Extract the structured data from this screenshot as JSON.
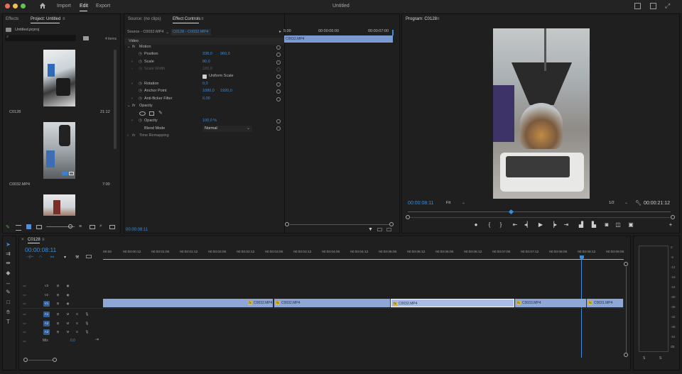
{
  "titlebar": {
    "nav": [
      "Import",
      "Edit",
      "Export"
    ],
    "title": "Untitled",
    "home_icon": "home-icon",
    "colors": {
      "close": "#ed6a5e",
      "minimize": "#f5bf4f",
      "zoom": "#61c554"
    }
  },
  "project_panel": {
    "tabs": [
      "Effects",
      "Project: Untitled"
    ],
    "file": "Untitled.prproj",
    "count": "4 items",
    "items": [
      {
        "name": "C0128",
        "duration": "21:12"
      },
      {
        "name": "C0032.MP4",
        "duration": "7:00"
      }
    ]
  },
  "effect_controls": {
    "tabs": [
      "Source: (no clips)",
      "Effect Controls"
    ],
    "master": "Source - C0032.MP4",
    "sequence_clip": "C0128 - C0032.MP4",
    "section_video": "Video",
    "motion": "Motion",
    "position_label": "Position",
    "position_x": "338,0",
    "position_y": "960,0",
    "scale_label": "Scale",
    "scale_value": "80,0",
    "scale_width_label": "Scale Width",
    "scale_width_value": "100,0",
    "uniform_scale_label": "Uniform Scale",
    "rotation_label": "Rotation",
    "rotation_value": "0,0",
    "anchor_label": "Anchor Point",
    "anchor_x": "1080,0",
    "anchor_y": "1920,0",
    "antiflicker_label": "Anti-flicker Filter",
    "antiflicker_value": "0,00",
    "opacity_section": "Opacity",
    "opacity_label": "Opacity",
    "opacity_value": "100,0 %",
    "blend_label": "Blend Mode",
    "blend_value": "Normal",
    "time_remap": "Time Remapping",
    "mini_times": [
      "5:00",
      "00:00:06:00",
      "00:00:07:00"
    ],
    "mini_clip": "C0032.MP4",
    "timecode": "00:00:08:11"
  },
  "program_monitor": {
    "title": "Program: C0128",
    "timecode": "00:00:08:11",
    "fit": "Fit",
    "resolution": "1/2",
    "duration": "00:00:21:12"
  },
  "timeline": {
    "tab": "C0128",
    "timecode": "00:00:08:11",
    "ruler": [
      "00:00",
      "00:00:00:12",
      "00:00:01:00",
      "00:00:01:12",
      "00:00:02:00",
      "00:00:02:12",
      "00:00:03:00",
      "00:00:03:12",
      "00:00:04:00",
      "00:00:04:12",
      "00:00:05:00",
      "00:00:05:12",
      "00:00:06:00",
      "00:00:06:12",
      "00:00:07:00",
      "00:00:07:12",
      "00:00:08:00",
      "00:00:08:12",
      "00:00:09:00"
    ],
    "video_tracks": [
      "V3",
      "V2",
      "V1"
    ],
    "audio_tracks": [
      "A1",
      "A2",
      "A3"
    ],
    "mix_label": "Mix",
    "mix_value": "0,0",
    "clips": [
      "C0032.MP4",
      "C0032.MP4",
      "C0032.MP4",
      "C0033.MP4",
      "C0031.MP4"
    ],
    "fx_badge": "fx",
    "m_label": "M",
    "s_label": "S"
  },
  "audio_meter": {
    "scale": [
      "0",
      "-6",
      "-12",
      "-18",
      "-24",
      "-30",
      "-36",
      "-42",
      "-48",
      "-54",
      "dB"
    ],
    "solo": [
      "S",
      "S"
    ]
  }
}
